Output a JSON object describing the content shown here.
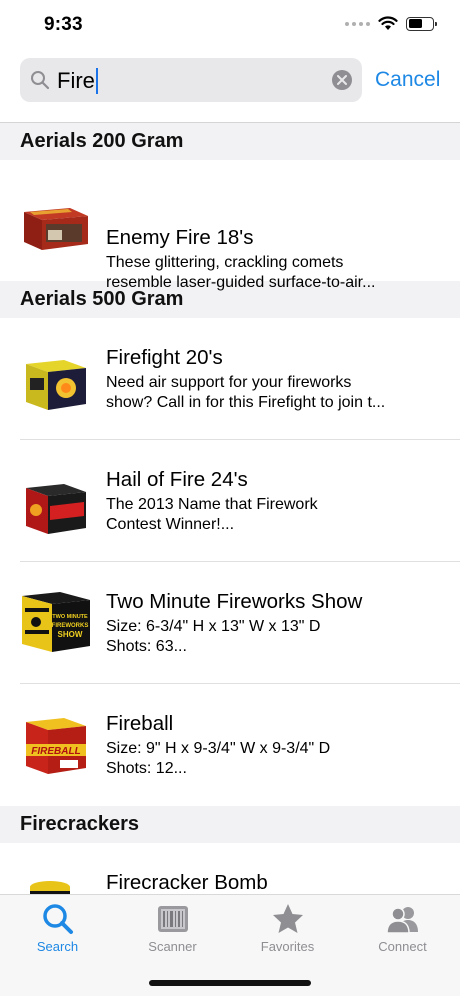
{
  "status_bar": {
    "time": "9:33"
  },
  "search": {
    "query": "Fire",
    "cancel_label": "Cancel"
  },
  "sections": [
    {
      "header": "Aerials 200 Gram",
      "items": [
        {
          "title": "Enemy Fire 18's",
          "line1": "These glittering, crackling comets",
          "line2": "resemble laser-guided surface-to-air..."
        }
      ]
    },
    {
      "header": "Aerials 500 Gram",
      "items": [
        {
          "title": "Firefight 20's",
          "line1": "Need air support for your fireworks",
          "line2": "show?  Call in for this Firefight to join t..."
        },
        {
          "title": "Hail of Fire 24's",
          "line1": "The 2013 Name that Firework",
          "line2": "Contest Winner!..."
        },
        {
          "title": "Two Minute Fireworks Show",
          "line1": "Size: 6-3/4\" H x 13\" W x 13\" D",
          "line2": "Shots: 63..."
        },
        {
          "title": "Fireball",
          "line1": "Size: 9\" H x 9-3/4\" W x 9-3/4\" D",
          "line2": "Shots: 12..."
        }
      ]
    },
    {
      "header": "Firecrackers",
      "items": [
        {
          "title": "Firecracker Bomb"
        }
      ]
    }
  ],
  "product_labels": {
    "two_minute": [
      "TWO MINUTE",
      "FIREWORKS",
      "SHOW"
    ],
    "fireball": "FIREBALL"
  },
  "tabs": [
    {
      "label": "Search",
      "icon": "search-icon",
      "active": true
    },
    {
      "label": "Scanner",
      "icon": "barcode-scanner-icon",
      "active": false
    },
    {
      "label": "Favorites",
      "icon": "star-icon",
      "active": false
    },
    {
      "label": "Connect",
      "icon": "people-icon",
      "active": false
    }
  ],
  "colors": {
    "accent": "#1e88e5",
    "inactive_tab": "#8e8e93",
    "section_bg": "#f2f2f4"
  }
}
